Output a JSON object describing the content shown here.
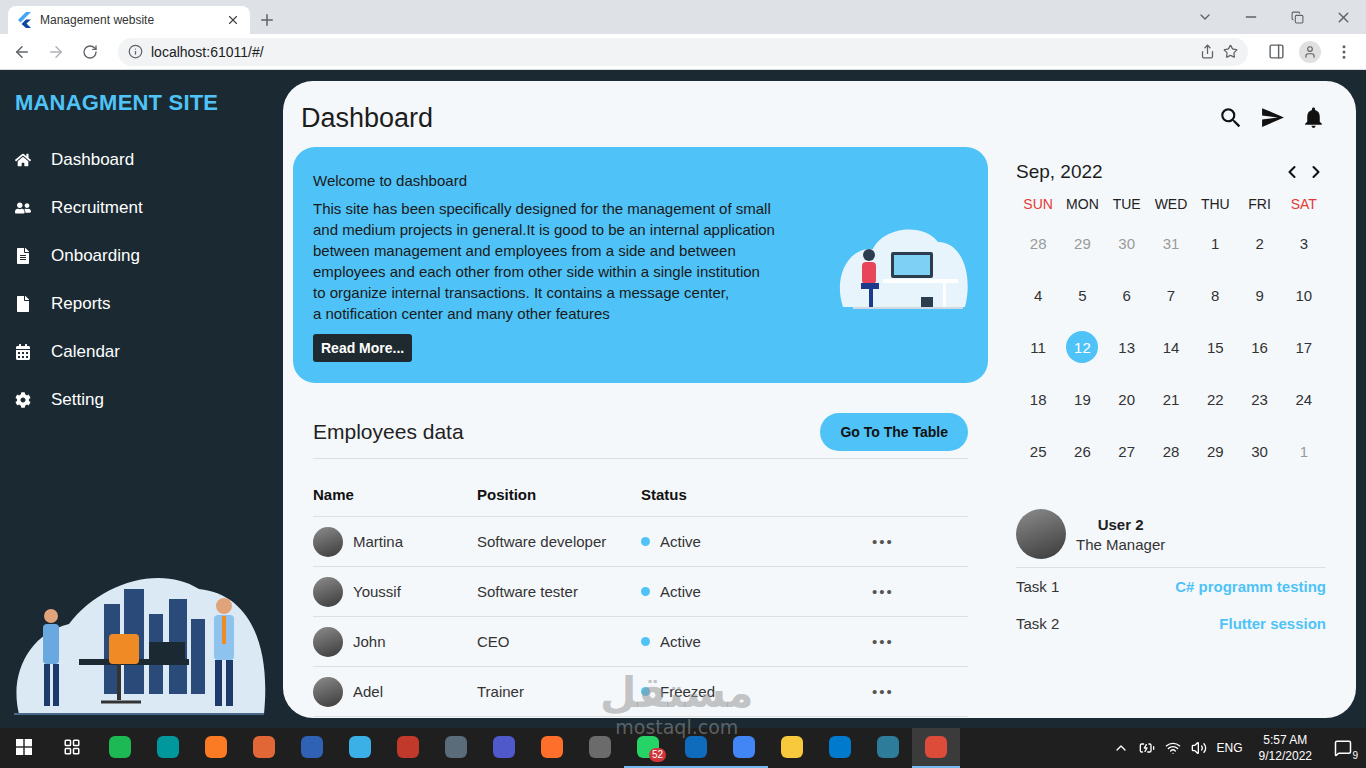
{
  "browser": {
    "tab_title": "Management website",
    "url": "localhost:61011/#/"
  },
  "app": {
    "brand": "MANAGMENT SITE",
    "page_title": "Dashboard"
  },
  "sidebar": {
    "items": [
      {
        "label": "Dashboard"
      },
      {
        "label": "Recruitment"
      },
      {
        "label": "Onboarding"
      },
      {
        "label": "Reports"
      },
      {
        "label": "Calendar"
      },
      {
        "label": "Setting"
      }
    ]
  },
  "welcome": {
    "title": "Welcome to dashboard",
    "lines": [
      "This site has been specifically designed for the management of small",
      "and medium projects in general.It is good to be an internal application",
      "between management and employees from a side and between",
      "employees and each other from other side within a single institution",
      "to organize internal transactions. It contains a message center,",
      "a notification center and many other features"
    ],
    "button": "Read More..."
  },
  "employees": {
    "title": "Employees data",
    "button": "Go To The Table",
    "columns": [
      "Name",
      "Position",
      "Status"
    ],
    "menu_glyph": "•••",
    "rows": [
      {
        "name": "Martina",
        "position": "Software developer",
        "status": "Active",
        "color": "#4fc3f7"
      },
      {
        "name": "Youssif",
        "position": "Software tester",
        "status": "Active",
        "color": "#4fc3f7"
      },
      {
        "name": "John",
        "position": "CEO",
        "status": "Active",
        "color": "#4fc3f7"
      },
      {
        "name": "Adel",
        "position": "Trainer",
        "status": "Freezed",
        "color": "#4fc3f7"
      }
    ]
  },
  "calendar": {
    "month": "Sep, 2022",
    "weekdays": [
      {
        "label": "SUN",
        "color": "#e53935"
      },
      {
        "label": "MON",
        "color": "#222222"
      },
      {
        "label": "TUE",
        "color": "#222222"
      },
      {
        "label": "WED",
        "color": "#222222"
      },
      {
        "label": "THU",
        "color": "#222222"
      },
      {
        "label": "FRI",
        "color": "#222222"
      },
      {
        "label": "SAT",
        "color": "#e53935"
      }
    ],
    "weeks": [
      [
        {
          "day": "28",
          "muted": true,
          "selected": false
        },
        {
          "day": "29",
          "muted": true,
          "selected": false
        },
        {
          "day": "30",
          "muted": true,
          "selected": false
        },
        {
          "day": "31",
          "muted": true,
          "selected": false
        },
        {
          "day": "1",
          "muted": false,
          "selected": false
        },
        {
          "day": "2",
          "muted": false,
          "selected": false
        },
        {
          "day": "3",
          "muted": false,
          "selected": false
        }
      ],
      [
        {
          "day": "4",
          "muted": false,
          "selected": false
        },
        {
          "day": "5",
          "muted": false,
          "selected": false
        },
        {
          "day": "6",
          "muted": false,
          "selected": false
        },
        {
          "day": "7",
          "muted": false,
          "selected": false
        },
        {
          "day": "8",
          "muted": false,
          "selected": false
        },
        {
          "day": "9",
          "muted": false,
          "selected": false
        },
        {
          "day": "10",
          "muted": false,
          "selected": false
        }
      ],
      [
        {
          "day": "11",
          "muted": false,
          "selected": false
        },
        {
          "day": "12",
          "muted": false,
          "selected": true
        },
        {
          "day": "13",
          "muted": false,
          "selected": false
        },
        {
          "day": "14",
          "muted": false,
          "selected": false
        },
        {
          "day": "15",
          "muted": false,
          "selected": false
        },
        {
          "day": "16",
          "muted": false,
          "selected": false
        },
        {
          "day": "17",
          "muted": false,
          "selected": false
        }
      ],
      [
        {
          "day": "18",
          "muted": false,
          "selected": false
        },
        {
          "day": "19",
          "muted": false,
          "selected": false
        },
        {
          "day": "20",
          "muted": false,
          "selected": false
        },
        {
          "day": "21",
          "muted": false,
          "selected": false
        },
        {
          "day": "22",
          "muted": false,
          "selected": false
        },
        {
          "day": "23",
          "muted": false,
          "selected": false
        },
        {
          "day": "24",
          "muted": false,
          "selected": false
        }
      ],
      [
        {
          "day": "25",
          "muted": false,
          "selected": false
        },
        {
          "day": "26",
          "muted": false,
          "selected": false
        },
        {
          "day": "27",
          "muted": false,
          "selected": false
        },
        {
          "day": "28",
          "muted": false,
          "selected": false
        },
        {
          "day": "29",
          "muted": false,
          "selected": false
        },
        {
          "day": "30",
          "muted": false,
          "selected": false
        },
        {
          "day": "1",
          "muted": true,
          "selected": false
        }
      ]
    ]
  },
  "user": {
    "name": "User 2",
    "role": "The Manager"
  },
  "tasks": [
    {
      "label": "Task 1",
      "value": "C# programm testing"
    },
    {
      "label": "Task 2",
      "value": "Flutter session"
    }
  ],
  "taskbar": {
    "apps": [
      {
        "color": "#1db954",
        "open": false,
        "selected": false,
        "badge": ""
      },
      {
        "color": "#00979d",
        "open": false,
        "selected": false,
        "badge": ""
      },
      {
        "color": "#fb7a24",
        "open": false,
        "selected": false,
        "badge": ""
      },
      {
        "color": "#e16737",
        "open": false,
        "selected": false,
        "badge": ""
      },
      {
        "color": "#2f61b4",
        "open": false,
        "selected": false,
        "badge": ""
      },
      {
        "color": "#3ab0e6",
        "open": false,
        "selected": false,
        "badge": ""
      },
      {
        "color": "#c0392b",
        "open": false,
        "selected": false,
        "badge": ""
      },
      {
        "color": "#5a6b7a",
        "open": false,
        "selected": false,
        "badge": ""
      },
      {
        "color": "#5059c9",
        "open": false,
        "selected": false,
        "badge": ""
      },
      {
        "color": "#ff6f2c",
        "open": false,
        "selected": false,
        "badge": ""
      },
      {
        "color": "#6b6b6b",
        "open": false,
        "selected": false,
        "badge": ""
      },
      {
        "color": "#25d366",
        "open": true,
        "selected": false,
        "badge": "52"
      },
      {
        "color": "#0f6cbd",
        "open": true,
        "selected": false,
        "badge": ""
      },
      {
        "color": "#4285f4",
        "open": true,
        "selected": false,
        "badge": ""
      },
      {
        "color": "#f8c93c",
        "open": false,
        "selected": false,
        "badge": ""
      },
      {
        "color": "#007acc",
        "open": false,
        "selected": false,
        "badge": ""
      },
      {
        "color": "#2d7d9a",
        "open": false,
        "selected": false,
        "badge": ""
      },
      {
        "color": "#dd4b39",
        "open": true,
        "selected": true,
        "badge": ""
      }
    ],
    "tray": {
      "language": "ENG",
      "time": "5:57 AM",
      "date": "9/12/2022",
      "notifications": "9"
    }
  },
  "watermark": {
    "text": "مستقل",
    "subtext": "mostaql.com"
  }
}
